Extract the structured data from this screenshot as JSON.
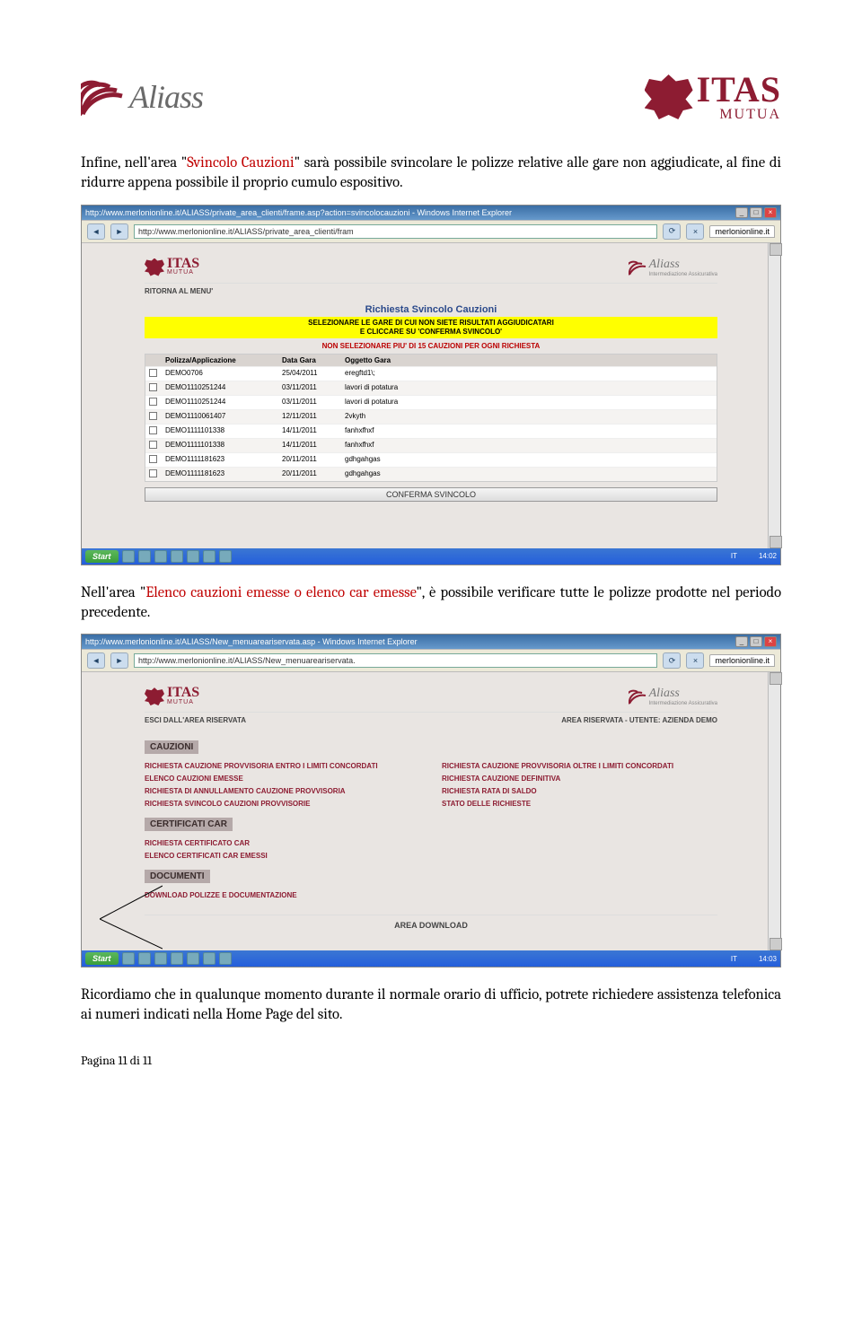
{
  "logos": {
    "aliass": "Aliass",
    "itas_main": "ITAS",
    "itas_sub": "MUTUA"
  },
  "para1": {
    "t1": "Infine, nell'area \"",
    "red1": "Svincolo Cauzioni",
    "t2": "\" sarà possibile svincolare le polizze relative alle gare non aggiudicate, al fine di ridurre appena possibile il proprio cumulo espositivo."
  },
  "para2": {
    "t1": "Nell'area \"",
    "red1": "Elenco cauzioni emesse o elenco car emesse",
    "t2": "\", è possibile verificare tutte le polizze prodotte nel periodo precedente."
  },
  "para3": "Ricordiamo che in qualunque momento durante il  normale orario di ufficio, potrete richiedere assistenza telefonica ai numeri indicati nella Home Page del sito.",
  "footer": "Pagina 11 di 11",
  "shot1": {
    "wintitle": "http://www.merlonionline.it/ALIASS/private_area_clienti/frame.asp?action=svincolocauzioni - Windows Internet Explorer",
    "url": "http://www.merlonionline.it/ALIASS/private_area_clienti/fram",
    "tab": "merlonionline.it",
    "ritorna": "RITORNA AL MENU'",
    "title": "Richiesta Svincolo Cauzioni",
    "yellow_l1": "SELEZIONARE LE GARE DI CUI NON SIETE RISULTATI AGGIUDICATARI",
    "yellow_l2": "E CLICCARE SU 'CONFERMA SVINCOLO'",
    "warn": "NON SELEZIONARE PIU' DI 15 CAUZIONI PER OGNI RICHIESTA",
    "headers": {
      "polizza": "Polizza/Applicazione",
      "data": "Data Gara",
      "oggetto": "Oggetto Gara"
    },
    "rows": [
      {
        "pol": "DEMO0706",
        "date": "25/04/2011",
        "obj": "eregftd1\\;"
      },
      {
        "pol": "DEMO1110251244",
        "date": "03/11/2011",
        "obj": "lavori di potatura"
      },
      {
        "pol": "DEMO1110251244",
        "date": "03/11/2011",
        "obj": "lavori di potatura"
      },
      {
        "pol": "DEMO1110061407",
        "date": "12/11/2011",
        "obj": "2vkyth"
      },
      {
        "pol": "DEMO1111101338",
        "date": "14/11/2011",
        "obj": "fanhxfhxf"
      },
      {
        "pol": "DEMO1111101338",
        "date": "14/11/2011",
        "obj": "fanhxfhxf"
      },
      {
        "pol": "DEMO1111181623",
        "date": "20/11/2011",
        "obj": "gdhgahgas"
      },
      {
        "pol": "DEMO1111181623",
        "date": "20/11/2011",
        "obj": "gdhgahgas"
      }
    ],
    "confirm": "CONFERMA SVINCOLO",
    "clock": "14:02",
    "lang": "IT"
  },
  "shot2": {
    "wintitle": "http://www.merlonionline.it/ALIASS/New_menuareariservata.asp - Windows Internet Explorer",
    "url": "http://www.merlonionline.it/ALIASS/New_menuareariservata.",
    "tab": "merlonionline.it",
    "esci": "ESCI DALL'AREA RISERVATA",
    "area_user": "AREA RISERVATA - UTENTE: AZIENDA DEMO",
    "sec_cauzioni": "CAUZIONI",
    "left": [
      "RICHIESTA CAUZIONE PROVVISORIA ENTRO I LIMITI CONCORDATI",
      "ELENCO CAUZIONI EMESSE",
      "RICHIESTA DI ANNULLAMENTO CAUZIONE PROVVISORIA",
      "RICHIESTA SVINCOLO CAUZIONI PROVVISORIE"
    ],
    "right": [
      "RICHIESTA CAUZIONE PROVVISORIA OLTRE I LIMITI CONCORDATI",
      "RICHIESTA CAUZIONE DEFINITIVA",
      "RICHIESTA RATA DI SALDO",
      "STATO DELLE RICHIESTE"
    ],
    "sec_car": "CERTIFICATI CAR",
    "car_links": [
      "RICHIESTA CERTIFICATO CAR",
      "ELENCO CERTIFICATI CAR EMESSI"
    ],
    "sec_doc": "DOCUMENTI",
    "doc_links": [
      "DOWNLOAD POLIZZE E DOCUMENTAZIONE"
    ],
    "area_download": "AREA DOWNLOAD",
    "clock": "14:03",
    "lang": "IT"
  },
  "taskbar": {
    "start": "Start"
  },
  "aliass_sub": "Intermediazione Assicurativa"
}
